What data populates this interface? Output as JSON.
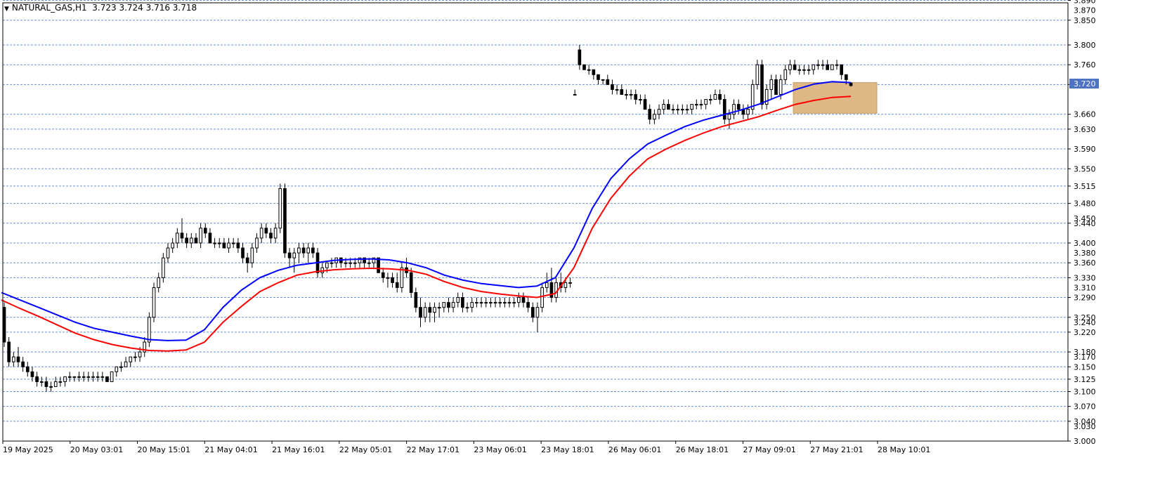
{
  "header": {
    "symbol": "NATURAL_GAS,H1",
    "ohlc": "3.723 3.724 3.716 3.718"
  },
  "colors": {
    "background": "#ffffff",
    "grid": "#6b8fd6",
    "candle": "#000000",
    "ma_fast": "#0000ff",
    "ma_slow": "#ff0000",
    "zone": "#deb887",
    "price_badge": "#4e72c4"
  },
  "chart_data": {
    "type": "candlestick",
    "ylim": [
      3.0,
      3.9
    ],
    "grid": true,
    "price_levels": [
      "3.890",
      "3.850",
      "3.800",
      "3.760",
      "3.720",
      "3.660",
      "3.630",
      "3.590",
      "3.550",
      "3.515",
      "3.480",
      "3.440",
      "3.400",
      "3.360",
      "3.330",
      "3.290",
      "3.250",
      "3.220",
      "3.180",
      "3.150",
      "3.125",
      "3.100",
      "3.070",
      "3.040",
      "3.000"
    ],
    "minor_ticks": [
      "3.870",
      "3.720",
      "3.450",
      "3.380",
      "3.310",
      "3.240",
      "3.170",
      "3.030"
    ],
    "x_ticks": [
      "19 May 2025",
      "20 May 03:01",
      "20 May 15:01",
      "21 May 04:01",
      "21 May 16:01",
      "22 May 05:01",
      "22 May 17:01",
      "23 May 06:01",
      "23 May 18:01",
      "26 May 06:01",
      "26 May 18:01",
      "27 May 09:01",
      "27 May 21:01",
      "28 May 10:01"
    ],
    "candles": [
      [
        3.27,
        3.28,
        3.19,
        3.2
      ],
      [
        3.2,
        3.21,
        3.15,
        3.16
      ],
      [
        3.16,
        3.18,
        3.15,
        3.17
      ],
      [
        3.17,
        3.19,
        3.15,
        3.16
      ],
      [
        3.16,
        3.17,
        3.14,
        3.15
      ],
      [
        3.15,
        3.16,
        3.13,
        3.14
      ],
      [
        3.14,
        3.15,
        3.12,
        3.13
      ],
      [
        3.13,
        3.14,
        3.11,
        3.12
      ],
      [
        3.12,
        3.13,
        3.11,
        3.12
      ],
      [
        3.12,
        3.13,
        3.1,
        3.11
      ],
      [
        3.11,
        3.12,
        3.1,
        3.11
      ],
      [
        3.11,
        3.13,
        3.11,
        3.12
      ],
      [
        3.12,
        3.13,
        3.11,
        3.12
      ],
      [
        3.12,
        3.13,
        3.11,
        3.13
      ],
      [
        3.13,
        3.14,
        3.12,
        3.13
      ],
      [
        3.13,
        3.13,
        3.12,
        3.13
      ],
      [
        3.13,
        3.14,
        3.12,
        3.13
      ],
      [
        3.13,
        3.14,
        3.12,
        3.13
      ],
      [
        3.13,
        3.14,
        3.12,
        3.13
      ],
      [
        3.13,
        3.14,
        3.12,
        3.13
      ],
      [
        3.13,
        3.14,
        3.12,
        3.13
      ],
      [
        3.13,
        3.14,
        3.12,
        3.13
      ],
      [
        3.13,
        3.13,
        3.12,
        3.12
      ],
      [
        3.12,
        3.14,
        3.12,
        3.14
      ],
      [
        3.14,
        3.15,
        3.13,
        3.15
      ],
      [
        3.15,
        3.16,
        3.14,
        3.15
      ],
      [
        3.15,
        3.17,
        3.15,
        3.16
      ],
      [
        3.16,
        3.17,
        3.15,
        3.17
      ],
      [
        3.17,
        3.18,
        3.16,
        3.17
      ],
      [
        3.17,
        3.19,
        3.16,
        3.18
      ],
      [
        3.18,
        3.21,
        3.17,
        3.2
      ],
      [
        3.2,
        3.26,
        3.19,
        3.25
      ],
      [
        3.25,
        3.32,
        3.24,
        3.31
      ],
      [
        3.31,
        3.34,
        3.3,
        3.33
      ],
      [
        3.33,
        3.38,
        3.32,
        3.37
      ],
      [
        3.37,
        3.4,
        3.36,
        3.39
      ],
      [
        3.39,
        3.41,
        3.38,
        3.4
      ],
      [
        3.4,
        3.43,
        3.39,
        3.42
      ],
      [
        3.42,
        3.45,
        3.4,
        3.41
      ],
      [
        3.41,
        3.42,
        3.39,
        3.4
      ],
      [
        3.4,
        3.42,
        3.39,
        3.41
      ],
      [
        3.41,
        3.42,
        3.4,
        3.4
      ],
      [
        3.4,
        3.44,
        3.39,
        3.43
      ],
      [
        3.43,
        3.44,
        3.41,
        3.42
      ],
      [
        3.42,
        3.43,
        3.4,
        3.4
      ],
      [
        3.4,
        3.41,
        3.39,
        3.4
      ],
      [
        3.4,
        3.41,
        3.39,
        3.4
      ],
      [
        3.4,
        3.41,
        3.39,
        3.39
      ],
      [
        3.39,
        3.41,
        3.38,
        3.4
      ],
      [
        3.4,
        3.41,
        3.39,
        3.4
      ],
      [
        3.4,
        3.41,
        3.38,
        3.39
      ],
      [
        3.39,
        3.4,
        3.36,
        3.37
      ],
      [
        3.37,
        3.38,
        3.34,
        3.36
      ],
      [
        3.36,
        3.4,
        3.35,
        3.39
      ],
      [
        3.39,
        3.42,
        3.38,
        3.41
      ],
      [
        3.41,
        3.44,
        3.4,
        3.43
      ],
      [
        3.43,
        3.44,
        3.41,
        3.42
      ],
      [
        3.42,
        3.43,
        3.4,
        3.41
      ],
      [
        3.41,
        3.44,
        3.4,
        3.43
      ],
      [
        3.43,
        3.52,
        3.42,
        3.51
      ],
      [
        3.51,
        3.52,
        3.37,
        3.38
      ],
      [
        3.38,
        3.39,
        3.35,
        3.37
      ],
      [
        3.37,
        3.39,
        3.34,
        3.38
      ],
      [
        3.38,
        3.4,
        3.36,
        3.39
      ],
      [
        3.39,
        3.4,
        3.37,
        3.38
      ],
      [
        3.38,
        3.4,
        3.36,
        3.39
      ],
      [
        3.39,
        3.4,
        3.37,
        3.38
      ],
      [
        3.38,
        3.39,
        3.33,
        3.34
      ],
      [
        3.34,
        3.36,
        3.33,
        3.35
      ],
      [
        3.35,
        3.36,
        3.34,
        3.36
      ],
      [
        3.36,
        3.37,
        3.35,
        3.36
      ],
      [
        3.36,
        3.37,
        3.35,
        3.37
      ],
      [
        3.37,
        3.37,
        3.35,
        3.36
      ],
      [
        3.36,
        3.37,
        3.35,
        3.36
      ],
      [
        3.36,
        3.37,
        3.35,
        3.36
      ],
      [
        3.36,
        3.37,
        3.35,
        3.36
      ],
      [
        3.36,
        3.37,
        3.35,
        3.37
      ],
      [
        3.37,
        3.37,
        3.35,
        3.36
      ],
      [
        3.36,
        3.37,
        3.35,
        3.36
      ],
      [
        3.36,
        3.37,
        3.35,
        3.37
      ],
      [
        3.37,
        3.37,
        3.34,
        3.34
      ],
      [
        3.34,
        3.35,
        3.32,
        3.33
      ],
      [
        3.33,
        3.34,
        3.31,
        3.33
      ],
      [
        3.33,
        3.34,
        3.31,
        3.32
      ],
      [
        3.32,
        3.34,
        3.3,
        3.31
      ],
      [
        3.31,
        3.36,
        3.3,
        3.35
      ],
      [
        3.35,
        3.37,
        3.33,
        3.34
      ],
      [
        3.34,
        3.35,
        3.29,
        3.3
      ],
      [
        3.3,
        3.31,
        3.26,
        3.27
      ],
      [
        3.27,
        3.29,
        3.23,
        3.25
      ],
      [
        3.25,
        3.28,
        3.24,
        3.27
      ],
      [
        3.27,
        3.28,
        3.24,
        3.26
      ],
      [
        3.26,
        3.28,
        3.24,
        3.27
      ],
      [
        3.27,
        3.28,
        3.25,
        3.27
      ],
      [
        3.27,
        3.28,
        3.26,
        3.28
      ],
      [
        3.28,
        3.29,
        3.26,
        3.27
      ],
      [
        3.27,
        3.29,
        3.26,
        3.28
      ],
      [
        3.28,
        3.3,
        3.27,
        3.29
      ],
      [
        3.29,
        3.3,
        3.26,
        3.27
      ],
      [
        3.27,
        3.28,
        3.26,
        3.27
      ],
      [
        3.27,
        3.29,
        3.26,
        3.28
      ],
      [
        3.28,
        3.29,
        3.27,
        3.28
      ],
      [
        3.28,
        3.29,
        3.27,
        3.28
      ],
      [
        3.28,
        3.29,
        3.27,
        3.28
      ],
      [
        3.28,
        3.29,
        3.27,
        3.28
      ],
      [
        3.28,
        3.29,
        3.27,
        3.28
      ],
      [
        3.28,
        3.29,
        3.27,
        3.28
      ],
      [
        3.28,
        3.29,
        3.27,
        3.28
      ],
      [
        3.28,
        3.29,
        3.27,
        3.28
      ],
      [
        3.28,
        3.29,
        3.27,
        3.28
      ],
      [
        3.28,
        3.3,
        3.27,
        3.29
      ],
      [
        3.29,
        3.3,
        3.27,
        3.28
      ],
      [
        3.28,
        3.29,
        3.26,
        3.27
      ],
      [
        3.27,
        3.28,
        3.24,
        3.25
      ],
      [
        3.25,
        3.28,
        3.22,
        3.27
      ],
      [
        3.27,
        3.32,
        3.26,
        3.31
      ],
      [
        3.31,
        3.34,
        3.3,
        3.32
      ],
      [
        3.32,
        3.35,
        3.28,
        3.29
      ],
      [
        3.29,
        3.33,
        3.28,
        3.32
      ],
      [
        3.32,
        3.34,
        3.3,
        3.31
      ],
      [
        3.31,
        3.33,
        3.3,
        3.32
      ],
      [
        3.32,
        3.33,
        3.31,
        3.32
      ],
      [
        3.7,
        3.71,
        3.7,
        3.7
      ],
      [
        3.79,
        3.8,
        3.75,
        3.76
      ],
      [
        3.76,
        3.76,
        3.75,
        3.75
      ],
      [
        3.75,
        3.76,
        3.74,
        3.75
      ],
      [
        3.75,
        3.75,
        3.73,
        3.74
      ],
      [
        3.74,
        3.74,
        3.72,
        3.73
      ],
      [
        3.73,
        3.73,
        3.72,
        3.73
      ],
      [
        3.73,
        3.74,
        3.72,
        3.72
      ],
      [
        3.72,
        3.73,
        3.7,
        3.71
      ],
      [
        3.71,
        3.72,
        3.7,
        3.71
      ],
      [
        3.71,
        3.72,
        3.7,
        3.7
      ],
      [
        3.7,
        3.71,
        3.69,
        3.7
      ],
      [
        3.7,
        3.71,
        3.69,
        3.7
      ],
      [
        3.7,
        3.71,
        3.68,
        3.69
      ],
      [
        3.69,
        3.7,
        3.68,
        3.69
      ],
      [
        3.69,
        3.7,
        3.67,
        3.67
      ],
      [
        3.67,
        3.68,
        3.64,
        3.65
      ],
      [
        3.65,
        3.67,
        3.64,
        3.66
      ],
      [
        3.66,
        3.68,
        3.65,
        3.67
      ],
      [
        3.67,
        3.69,
        3.66,
        3.68
      ],
      [
        3.68,
        3.69,
        3.67,
        3.67
      ],
      [
        3.67,
        3.68,
        3.66,
        3.67
      ],
      [
        3.67,
        3.68,
        3.66,
        3.67
      ],
      [
        3.67,
        3.68,
        3.66,
        3.67
      ],
      [
        3.67,
        3.68,
        3.66,
        3.67
      ],
      [
        3.67,
        3.68,
        3.66,
        3.68
      ],
      [
        3.68,
        3.69,
        3.67,
        3.68
      ],
      [
        3.68,
        3.69,
        3.67,
        3.68
      ],
      [
        3.68,
        3.69,
        3.67,
        3.69
      ],
      [
        3.69,
        3.7,
        3.68,
        3.69
      ],
      [
        3.69,
        3.71,
        3.69,
        3.7
      ],
      [
        3.7,
        3.71,
        3.68,
        3.69
      ],
      [
        3.69,
        3.7,
        3.64,
        3.65
      ],
      [
        3.65,
        3.67,
        3.63,
        3.66
      ],
      [
        3.66,
        3.69,
        3.65,
        3.68
      ],
      [
        3.68,
        3.69,
        3.66,
        3.67
      ],
      [
        3.67,
        3.68,
        3.65,
        3.66
      ],
      [
        3.66,
        3.68,
        3.65,
        3.67
      ],
      [
        3.67,
        3.73,
        3.66,
        3.72
      ],
      [
        3.72,
        3.77,
        3.71,
        3.76
      ],
      [
        3.76,
        3.77,
        3.67,
        3.68
      ],
      [
        3.68,
        3.72,
        3.67,
        3.71
      ],
      [
        3.71,
        3.74,
        3.69,
        3.73
      ],
      [
        3.73,
        3.74,
        3.7,
        3.7
      ],
      [
        3.7,
        3.74,
        3.69,
        3.73
      ],
      [
        3.73,
        3.76,
        3.72,
        3.75
      ],
      [
        3.75,
        3.77,
        3.74,
        3.76
      ],
      [
        3.76,
        3.77,
        3.75,
        3.75
      ],
      [
        3.75,
        3.76,
        3.74,
        3.75
      ],
      [
        3.75,
        3.76,
        3.74,
        3.75
      ],
      [
        3.75,
        3.76,
        3.74,
        3.75
      ],
      [
        3.75,
        3.76,
        3.74,
        3.76
      ],
      [
        3.76,
        3.77,
        3.75,
        3.76
      ],
      [
        3.76,
        3.77,
        3.75,
        3.76
      ],
      [
        3.76,
        3.77,
        3.75,
        3.75
      ],
      [
        3.75,
        3.76,
        3.75,
        3.76
      ],
      [
        3.76,
        3.77,
        3.75,
        3.76
      ],
      [
        3.76,
        3.76,
        3.73,
        3.74
      ],
      [
        3.74,
        3.74,
        3.72,
        3.73
      ],
      [
        3.723,
        3.724,
        3.716,
        3.718
      ]
    ],
    "ma_fast": [
      3.3,
      3.285,
      3.27,
      3.255,
      3.24,
      3.228,
      3.22,
      3.212,
      3.205,
      3.203,
      3.204,
      3.225,
      3.27,
      3.305,
      3.33,
      3.345,
      3.355,
      3.36,
      3.365,
      3.367,
      3.368,
      3.366,
      3.36,
      3.35,
      3.335,
      3.325,
      3.318,
      3.314,
      3.31,
      3.313,
      3.33,
      3.39,
      3.47,
      3.53,
      3.57,
      3.6,
      3.618,
      3.635,
      3.648,
      3.658,
      3.668,
      3.68,
      3.695,
      3.71,
      3.721,
      3.726,
      3.724
    ],
    "ma_slow": [
      3.285,
      3.268,
      3.252,
      3.235,
      3.218,
      3.205,
      3.195,
      3.188,
      3.183,
      3.182,
      3.184,
      3.2,
      3.24,
      3.272,
      3.302,
      3.32,
      3.335,
      3.342,
      3.346,
      3.348,
      3.349,
      3.348,
      3.345,
      3.337,
      3.322,
      3.31,
      3.302,
      3.297,
      3.293,
      3.29,
      3.298,
      3.35,
      3.43,
      3.49,
      3.535,
      3.57,
      3.59,
      3.607,
      3.622,
      3.635,
      3.645,
      3.655,
      3.668,
      3.68,
      3.688,
      3.694,
      3.696
    ],
    "zone": {
      "start_candle": 169,
      "price_high": 3.724,
      "price_low": 3.662
    },
    "current_price_line": 3.722
  }
}
